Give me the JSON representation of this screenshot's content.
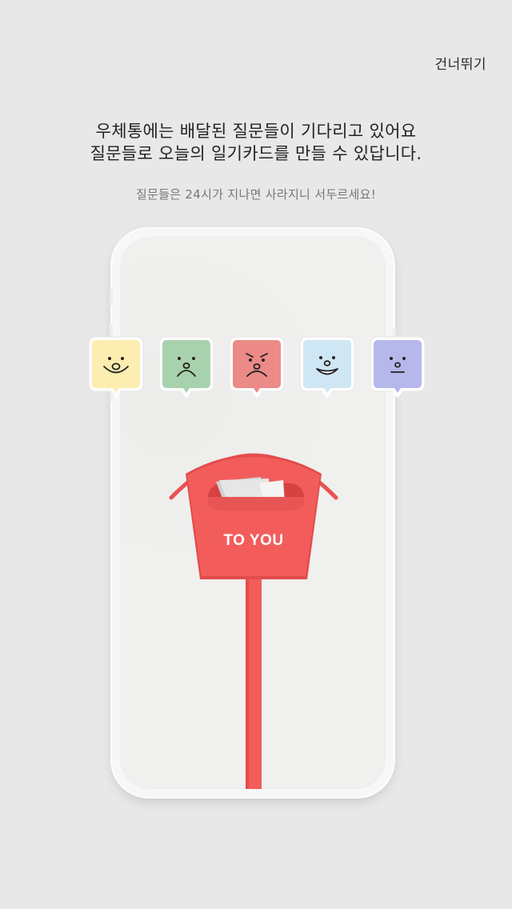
{
  "header": {
    "skip_label": "건너뛰기"
  },
  "intro": {
    "line1": "우체통에는 배달된 질문들이 기다리고 있어요",
    "line2": "질문들로 오늘의 일기카드를 만들 수 있답니다.",
    "note": "질문들은 24시가 지나면 사라지니 서두르세요!"
  },
  "moods": [
    {
      "name": "happy-face-icon",
      "color": "#fbeeb0"
    },
    {
      "name": "sad-face-icon",
      "color": "#a8d2ad"
    },
    {
      "name": "angry-face-icon",
      "color": "#ec8a87"
    },
    {
      "name": "joyful-face-icon",
      "color": "#cfe6f4"
    },
    {
      "name": "neutral-face-icon",
      "color": "#b6b8ec"
    }
  ],
  "mailbox": {
    "label": "TO YOU",
    "color": "#f25d5c"
  }
}
